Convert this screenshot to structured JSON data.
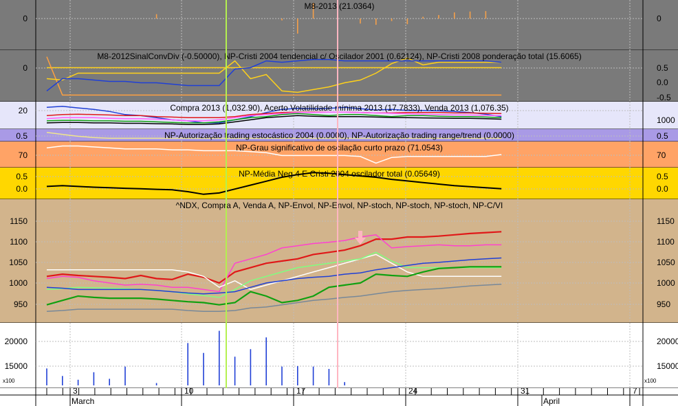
{
  "chart_data": [
    {
      "type": "bar",
      "title": "M8-2013 (21.0364)",
      "y_ticks_left": [
        "0"
      ],
      "y_ticks_right": [
        "0"
      ],
      "bg": "#7a7a7a",
      "color": "#f5a04a",
      "x": [
        4,
        7,
        8,
        11,
        12,
        14,
        16,
        17,
        18,
        19,
        20,
        21,
        22,
        23,
        24,
        25,
        26,
        27,
        28,
        29
      ],
      "values": [
        0,
        0,
        1,
        0,
        0,
        0,
        -0.3,
        -2.4,
        3.6,
        0,
        0,
        -0.8,
        -1.0,
        -0.4,
        -0.9,
        0.4,
        0.8,
        1.4,
        1.6,
        1.7
      ]
    },
    {
      "type": "line",
      "title": "M8-2012SinalConvDiv (-0.50000), NP-Cristi 2004 tendencial c/ Oscilador 2001 (0.62124), NP-Cristi 2008 ponderação total (15.6065)",
      "y_ticks_left": [
        "0"
      ],
      "y_ticks_right": [
        "0.5",
        "0.0",
        "-0.5"
      ],
      "bg": "#7a7a7a",
      "series": [
        {
          "color": "#ffd11a",
          "x": [
            1,
            2,
            3,
            4,
            5,
            6,
            7,
            8,
            9,
            10,
            11,
            12,
            13,
            14,
            15,
            16,
            17,
            18,
            19,
            20,
            21,
            22,
            23,
            24,
            25,
            26,
            27,
            28,
            29,
            30
          ],
          "values": [
            0.5,
            0.5,
            0.5,
            0.5,
            0.5,
            0.5,
            0.5,
            0.5,
            0.5,
            0.5,
            0.5,
            0.5,
            0.5,
            0.5,
            0.5,
            0.5,
            0.5,
            0.5,
            0.5,
            0.5,
            0.5,
            0.5,
            0.5,
            0.5,
            0.5,
            0.5,
            0.5,
            0.5,
            0.5,
            0.5
          ]
        },
        {
          "color": "#ffa040",
          "x": [
            1,
            2,
            3,
            4,
            5,
            6,
            7,
            8,
            9,
            10,
            11,
            12,
            13,
            14,
            15,
            16,
            17,
            18,
            19,
            20,
            21,
            22,
            23,
            24,
            25,
            26,
            27,
            28,
            29,
            30
          ],
          "values": [
            0.9,
            -0.5,
            -0.5,
            -0.5,
            -0.5,
            -0.5,
            -0.5,
            -0.5,
            -0.5,
            -0.5,
            -0.5,
            -0.5,
            -0.5,
            -0.5,
            -0.5,
            -0.5,
            -0.5,
            -0.5,
            -0.5,
            -0.5,
            -0.5,
            -0.5,
            -0.5,
            -0.5,
            -0.5,
            -0.5,
            -0.5,
            -0.5,
            -0.5,
            -0.5
          ]
        },
        {
          "color": "#ffd11a",
          "x": [
            1,
            2,
            3,
            4,
            5,
            6,
            7,
            8,
            9,
            10,
            11,
            12,
            13,
            14,
            15,
            16,
            17,
            18,
            19,
            20,
            21,
            22,
            23,
            24,
            25,
            26,
            27,
            28,
            29,
            30
          ],
          "values": [
            0.1,
            0.05,
            0.3,
            0.3,
            0.3,
            0.3,
            0.3,
            0.3,
            0.3,
            0.3,
            0.3,
            0.3,
            0.75,
            0.1,
            0.25,
            -0.35,
            -0.4,
            -0.3,
            -0.2,
            -0.05,
            0.05,
            0.3,
            0.65,
            0.85,
            0.6,
            0.7,
            0.7,
            0.7,
            0.7,
            0.7
          ]
        },
        {
          "color": "#1f3fd6",
          "x": [
            1,
            2,
            3,
            4,
            5,
            6,
            7,
            8,
            9,
            10,
            11,
            12,
            13,
            14,
            15,
            16,
            17,
            18,
            19,
            20,
            21,
            22,
            23,
            24,
            25,
            26,
            27,
            28,
            29,
            30
          ],
          "values": [
            -0.35,
            0.1,
            0.1,
            0.05,
            0.0,
            0.0,
            -0.05,
            -0.05,
            -0.1,
            -0.15,
            -0.15,
            -0.15,
            0.45,
            0.5,
            0.75,
            0.7,
            0.75,
            0.8,
            0.8,
            0.75,
            0.75,
            0.75,
            0.75,
            0.75,
            0.75,
            0.75,
            0.75,
            0.75,
            0.75,
            0.7
          ]
        }
      ]
    },
    {
      "type": "line",
      "title": "Compra 2013 (1,032.90), Acerto Volatilidade mínima 2013 (17.7833), Venda 2013 (1,076.35)",
      "y_ticks_left": [
        "20"
      ],
      "y_ticks_right": [
        "1000"
      ],
      "bg": "#e6e6fa",
      "series": [
        {
          "color": "#1f3fd6",
          "values": [
            0.95,
            1.0,
            0.92,
            0.85,
            0.75,
            0.6,
            0.55,
            0.45,
            0.35,
            0.3,
            0.2,
            0.2,
            0.35,
            0.5,
            0.7,
            0.85,
            0.9,
            0.88,
            0.9,
            0.95,
            0.88,
            0.82,
            0.85,
            0.8,
            0.8,
            0.78,
            0.75,
            0.7,
            0.62,
            0.5
          ]
        },
        {
          "color": "#e01818",
          "values": [
            0.55,
            0.6,
            0.62,
            0.6,
            0.58,
            0.55,
            0.55,
            0.5,
            0.48,
            0.45,
            0.45,
            0.45,
            0.5,
            0.6,
            0.65,
            0.7,
            0.72,
            0.72,
            0.72,
            0.72,
            0.7,
            0.68,
            0.68,
            0.7,
            0.7,
            0.7,
            0.68,
            0.68,
            0.66,
            0.65
          ]
        },
        {
          "color": "#ff60ff",
          "values": [
            0.4,
            0.45,
            0.45,
            0.45,
            0.42,
            0.4,
            0.4,
            0.38,
            0.35,
            0.3,
            0.3,
            0.35,
            0.45,
            0.55,
            0.6,
            0.65,
            0.7,
            0.7,
            0.72,
            0.72,
            0.7,
            0.68,
            0.66,
            0.64,
            0.62,
            0.6,
            0.58,
            0.58,
            0.56,
            0.55
          ]
        },
        {
          "color": "#10a010",
          "values": [
            0.3,
            0.32,
            0.32,
            0.3,
            0.3,
            0.28,
            0.28,
            0.25,
            0.22,
            0.2,
            0.2,
            0.25,
            0.35,
            0.45,
            0.5,
            0.6,
            0.65,
            0.6,
            0.55,
            0.6,
            0.6,
            0.55,
            0.5,
            0.55,
            0.55,
            0.52,
            0.5,
            0.5,
            0.48,
            0.45
          ]
        },
        {
          "color": "#000000",
          "values": [
            0.2,
            0.22,
            0.22,
            0.2,
            0.2,
            0.18,
            0.18,
            0.16,
            0.15,
            0.12,
            0.12,
            0.15,
            0.25,
            0.35,
            0.45,
            0.5,
            0.55,
            0.52,
            0.5,
            0.5,
            0.5,
            0.48,
            0.46,
            0.45,
            0.44,
            0.43,
            0.42,
            0.42,
            0.4,
            0.38
          ]
        }
      ]
    },
    {
      "type": "line",
      "title": "NP-Autorização trading estocástico 2004 (0.0000), NP-Autorização trading range/trend (0.0000)",
      "y_ticks_left": [
        "0.5"
      ],
      "y_ticks_right": [
        "0.5"
      ],
      "bg": "#a99ae6",
      "series": [
        {
          "color": "#f0e68c",
          "values": [
            0.9,
            0.6,
            0.3,
            0.1,
            0,
            0,
            0,
            0,
            0,
            0,
            0,
            0,
            0,
            0,
            0,
            0,
            0,
            0,
            0,
            0,
            0,
            0,
            0,
            0,
            0,
            0,
            0,
            0,
            0,
            0
          ]
        }
      ]
    },
    {
      "type": "line",
      "title": "NP-Grau significativo de oscilação curto prazo (71.0543)",
      "y_ticks_left": [
        "70"
      ],
      "y_ticks_right": [
        "70"
      ],
      "bg": "#ffa366",
      "series": [
        {
          "color": "#ffffff",
          "values": [
            78,
            80,
            80,
            79,
            78,
            77,
            77,
            77,
            76,
            76,
            75,
            75,
            75,
            74,
            73,
            70,
            70,
            70,
            70,
            70,
            69,
            62,
            68,
            69,
            69,
            69,
            69,
            69,
            69,
            71
          ]
        }
      ]
    },
    {
      "type": "line",
      "title": "NP-Média Neg 4 E Cristi 2004 oscilador total (0.05649)",
      "y_ticks_left": [
        "0.5",
        "0.0"
      ],
      "y_ticks_right": [
        "0.5",
        "0.0"
      ],
      "bg": "#ffd700",
      "series": [
        {
          "color": "#000000",
          "values": [
            0.15,
            0.18,
            0.15,
            0.12,
            0.1,
            0.08,
            0.06,
            0.04,
            0.02,
            -0.05,
            -0.15,
            -0.1,
            0.05,
            0.2,
            0.35,
            0.5,
            0.6,
            0.68,
            0.65,
            0.6,
            0.55,
            0.5,
            0.42,
            0.36,
            0.3,
            0.24,
            0.18,
            0.14,
            0.1,
            0.06
          ]
        }
      ]
    },
    {
      "type": "line",
      "title": "^NDX, Compra A, Venda A, NP-Envol, NP-Envol, NP-stoch, NP-stoch, NP-stoch, NP-C/VI",
      "y_ticks_left": [
        "1150",
        "1100",
        "1050",
        "1000",
        "950"
      ],
      "y_ticks_right": [
        "1150",
        "1100",
        "1050",
        "1000",
        "950"
      ],
      "ylim": [
        910,
        1180
      ],
      "bg": "#d2b48c",
      "series": [
        {
          "name": "",
          "color": "#e01818",
          "values": [
            1010,
            1015,
            1012,
            1010,
            1008,
            1005,
            1012,
            1005,
            1003,
            1015,
            1008,
            995,
            1020,
            1030,
            1040,
            1045,
            1050,
            1060,
            1065,
            1070,
            1080,
            1095,
            1095,
            1100,
            1100,
            1102,
            1105,
            1108,
            1110,
            1112
          ]
        },
        {
          "name": "",
          "color": "#ff40d0",
          "values": [
            1005,
            1010,
            1008,
            1000,
            995,
            990,
            992,
            990,
            985,
            985,
            980,
            975,
            1040,
            1050,
            1060,
            1075,
            1080,
            1085,
            1088,
            1092,
            1100,
            1105,
            1075,
            1078,
            1080,
            1082,
            1080,
            1080,
            1082,
            1082
          ]
        },
        {
          "name": "",
          "color": "#ffffff",
          "values": [
            1025,
            1025,
            1025,
            1025,
            1025,
            1025,
            1025,
            1025,
            1025,
            1020,
            1010,
            985,
            1000,
            980,
            990,
            1000,
            1010,
            1020,
            1030,
            1040,
            1050,
            1060,
            1040,
            1020,
            1010,
            1010,
            1010,
            1010,
            1010,
            1010
          ]
        },
        {
          "name": "",
          "color": "#7fff7f",
          "values": [
            980,
            982,
            985,
            984,
            983,
            982,
            980,
            978,
            975,
            970,
            966,
            962,
            980,
            1000,
            1010,
            1020,
            1030,
            1035,
            1040,
            1045,
            1050,
            1065,
            1045,
            1030,
            1030,
            1030,
            1030,
            1030,
            1030,
            1030
          ]
        },
        {
          "name": "",
          "color": "#1f3fd6",
          "values": [
            985,
            983,
            980,
            980,
            980,
            980,
            980,
            978,
            975,
            972,
            970,
            972,
            975,
            985,
            995,
            1000,
            1005,
            1008,
            1010,
            1015,
            1018,
            1025,
            1030,
            1035,
            1040,
            1042,
            1045,
            1048,
            1050,
            1052
          ]
        },
        {
          "name": "",
          "color": "#10a010",
          "values": [
            945,
            955,
            965,
            962,
            960,
            960,
            960,
            958,
            955,
            952,
            950,
            945,
            950,
            975,
            965,
            950,
            955,
            965,
            985,
            990,
            995,
            1015,
            1012,
            1010,
            1020,
            1028,
            1030,
            1032,
            1032,
            1032
          ]
        },
        {
          "name": "",
          "color": "#778899",
          "values": [
            930,
            932,
            935,
            935,
            935,
            935,
            935,
            935,
            935,
            932,
            930,
            930,
            932,
            938,
            940,
            945,
            950,
            955,
            958,
            962,
            965,
            970,
            975,
            978,
            980,
            982,
            985,
            988,
            990,
            992
          ]
        }
      ]
    },
    {
      "type": "bar",
      "title": "",
      "y_ticks_left": [
        "20000",
        "15000"
      ],
      "y_ticks_right": [
        "20000",
        "15000"
      ],
      "unit_label": "x100",
      "ylim": [
        10800,
        23500
      ],
      "bg": "#ffffff",
      "color": "#1f3fd6",
      "x": [
        1,
        2,
        3,
        4,
        5,
        6,
        7,
        8,
        9,
        10,
        11,
        12,
        13,
        14,
        15,
        16,
        17,
        18,
        19,
        20,
        21,
        22,
        23,
        24,
        25,
        26,
        27,
        28,
        29,
        30
      ],
      "values": [
        14400,
        12800,
        12000,
        13600,
        12200,
        14800,
        0,
        11300,
        0,
        19800,
        17700,
        22400,
        16900,
        18500,
        21000,
        14800,
        14900,
        14800,
        14300,
        11500,
        0,
        0,
        0,
        0,
        0,
        0,
        0,
        0,
        0,
        0
      ]
    }
  ],
  "x_axis": {
    "day_labels": [
      "3",
      "10",
      "17",
      "24",
      "31",
      "7"
    ],
    "month_labels": [
      "March",
      "April"
    ]
  },
  "colors": {
    "vline_green": "#b4f050",
    "vline_pink": "#ffb6c1",
    "arrow": "#ffb6c1",
    "grid": "#c8c8c8"
  }
}
